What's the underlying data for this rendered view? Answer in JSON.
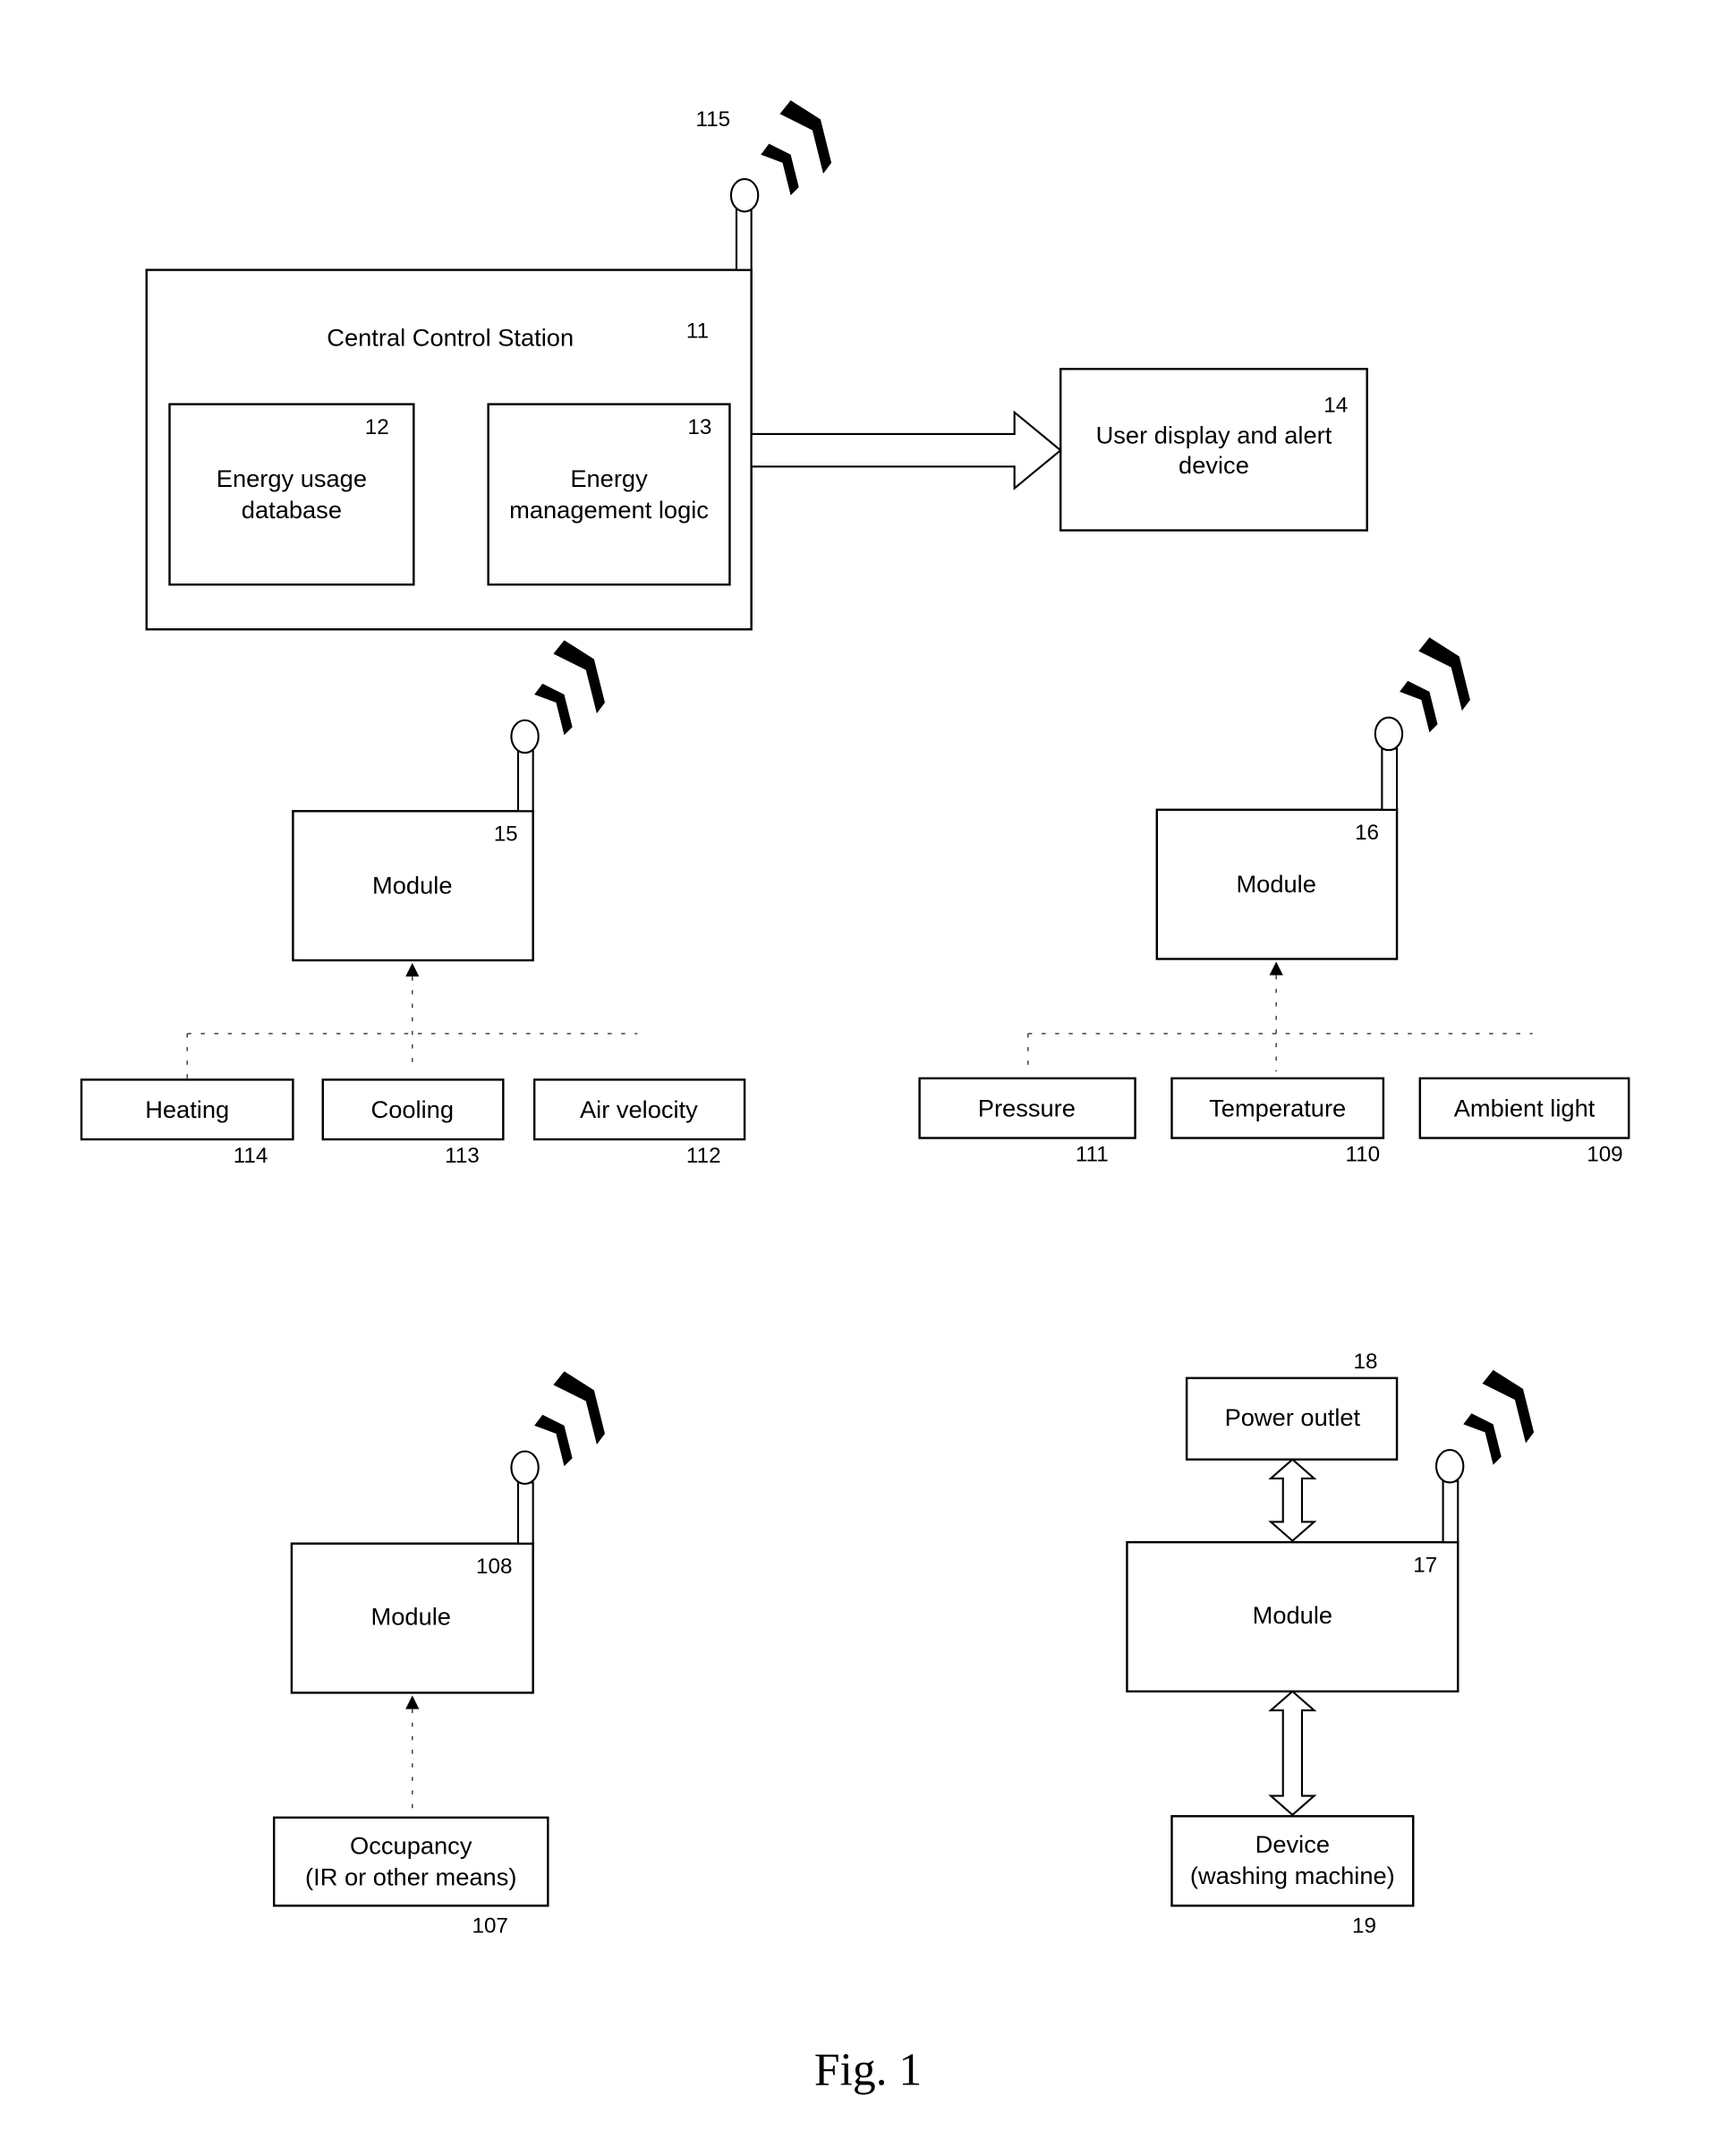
{
  "figure": {
    "caption": "Fig. 1",
    "central_station": {
      "label": "Central Control Station",
      "ref": "11",
      "antenna_ref": "115"
    },
    "database": {
      "label_line1": "Energy usage",
      "label_line2": "database",
      "ref": "12"
    },
    "logic": {
      "label_line1": "Energy",
      "label_line2": "management logic",
      "ref": "13"
    },
    "display": {
      "label_line1": "User display and alert",
      "label_line2": "device",
      "ref": "14"
    },
    "module_a": {
      "label": "Module",
      "ref": "15"
    },
    "module_b": {
      "label": "Module",
      "ref": "16"
    },
    "module_c": {
      "label": "Module",
      "ref": "108"
    },
    "module_d": {
      "label": "Module",
      "ref": "17"
    },
    "sensors_a": [
      {
        "label": "Heating",
        "ref": "114"
      },
      {
        "label": "Cooling",
        "ref": "113"
      },
      {
        "label": "Air velocity",
        "ref": "112"
      }
    ],
    "sensors_b": [
      {
        "label": "Pressure",
        "ref": "111"
      },
      {
        "label": "Temperature",
        "ref": "110"
      },
      {
        "label": "Ambient light",
        "ref": "109"
      }
    ],
    "occupancy": {
      "label_line1": "Occupancy",
      "label_line2": "(IR or other means)",
      "ref": "107"
    },
    "power_outlet": {
      "label": "Power outlet",
      "ref": "18"
    },
    "device": {
      "label_line1": "Device",
      "label_line2": "(washing machine)",
      "ref": "19"
    }
  }
}
